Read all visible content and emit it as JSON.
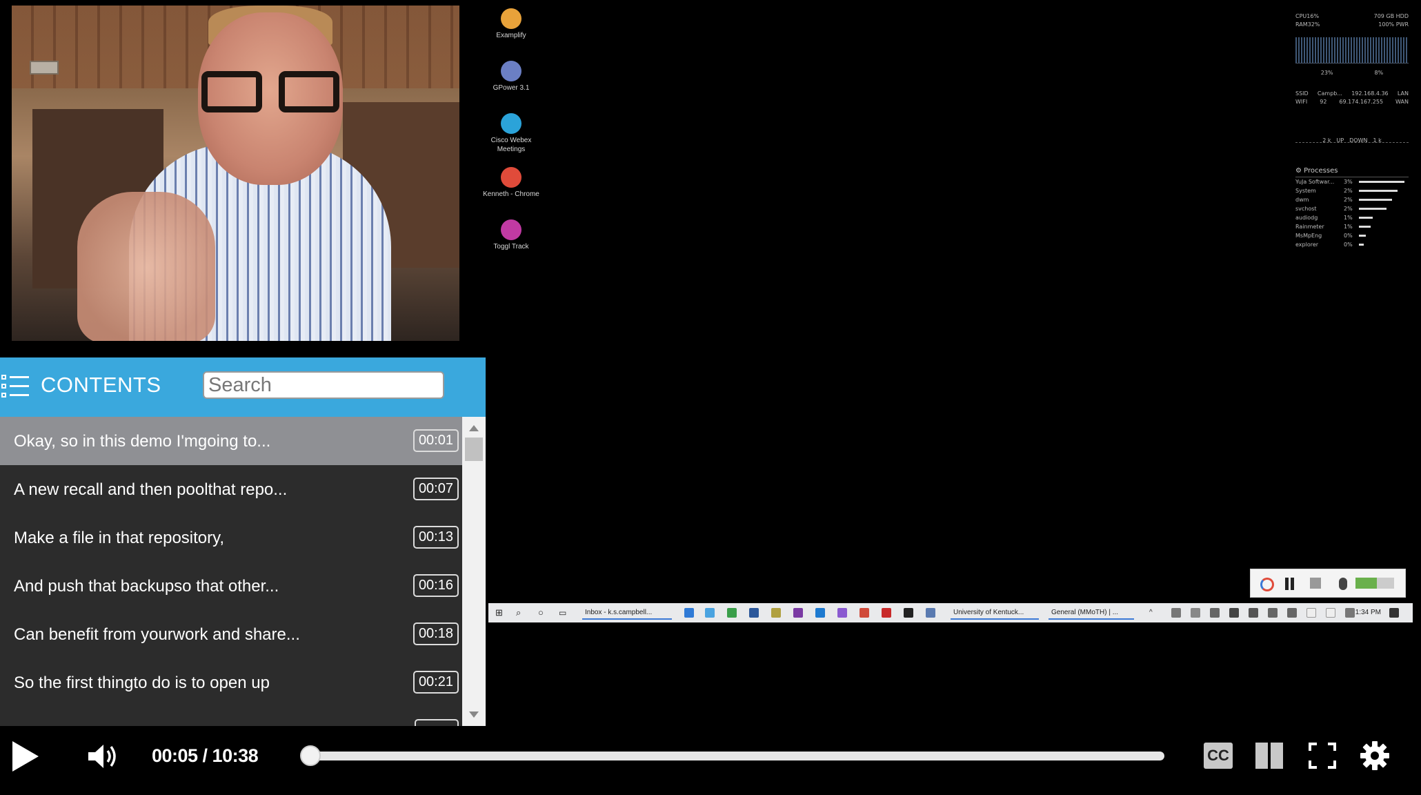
{
  "desktop_icons": [
    {
      "label": "Examplify",
      "icon": "examplify-icon",
      "color": "#e8a23a"
    },
    {
      "label": "GPower 3.1",
      "icon": "gpower-icon",
      "color": "#6b7fc4"
    },
    {
      "label": "Cisco Webex Meetings",
      "icon": "webex-icon",
      "color": "#2ba3d9"
    },
    {
      "label": "Kenneth - Chrome",
      "icon": "chrome-icon",
      "color": "#e04b3a"
    },
    {
      "label": "Toggl Track",
      "icon": "toggl-icon",
      "color": "#c13aa3"
    }
  ],
  "system_monitor": {
    "cpu_label": "CPU",
    "cpu_value": "16%",
    "ram_label": "RAM",
    "ram_value": "32%",
    "hdd_value": "709 GB",
    "hdd_label": "HDD",
    "pwr_value": "100%",
    "pwr_label": "PWR",
    "graph_left": "23%",
    "graph_right": "8%",
    "ssid_label": "SSID",
    "ssid_value": "Campb...",
    "lan_ip": "192.168.4.36",
    "lan_label": "LAN",
    "wifi_label": "WIFI",
    "wifi_value": "92",
    "wan_ip": "69.174.167.255",
    "wan_label": "WAN",
    "up_value": "2 k",
    "up_label": "UP",
    "down_label": "DOWN",
    "down_value": "1 k",
    "processes_title": "Processes",
    "processes": [
      {
        "name": "YuJa Softwar...",
        "pct": "3%",
        "level": 1.0
      },
      {
        "name": "System",
        "pct": "2%",
        "level": 0.85
      },
      {
        "name": "dwm",
        "pct": "2%",
        "level": 0.72
      },
      {
        "name": "svchost",
        "pct": "2%",
        "level": 0.6
      },
      {
        "name": "audiodg",
        "pct": "1%",
        "level": 0.3
      },
      {
        "name": "Rainmeter",
        "pct": "1%",
        "level": 0.25
      },
      {
        "name": "MsMpEng",
        "pct": "0%",
        "level": 0.15
      },
      {
        "name": "explorer",
        "pct": "0%",
        "level": 0.1
      }
    ]
  },
  "contents": {
    "title": "CONTENTS",
    "search_placeholder": "Search",
    "items": [
      {
        "text": "Okay, so in this demo I'mgoing to...",
        "time": "00:01",
        "active": true
      },
      {
        "text": "A new recall and then poolthat repo...",
        "time": "00:07"
      },
      {
        "text": "Make a file in that repository,",
        "time": "00:13"
      },
      {
        "text": "And push that backupso that other...",
        "time": "00:16"
      },
      {
        "text": "Can benefit from yourwork and share...",
        "time": "00:18"
      },
      {
        "text": "So the first thingto do is to open up",
        "time": "00:21"
      },
      {
        "text": "",
        "time": ""
      }
    ]
  },
  "taskbar": {
    "apps": [
      {
        "label": "Inbox - k.s.campbell..."
      },
      {
        "label": "University of Kentuck..."
      },
      {
        "label": "General (MMoTH) | ..."
      }
    ],
    "clock": "1:34 PM"
  },
  "player": {
    "time": "00:05 / 10:38",
    "progress": 0.008,
    "cc_label": "CC"
  }
}
